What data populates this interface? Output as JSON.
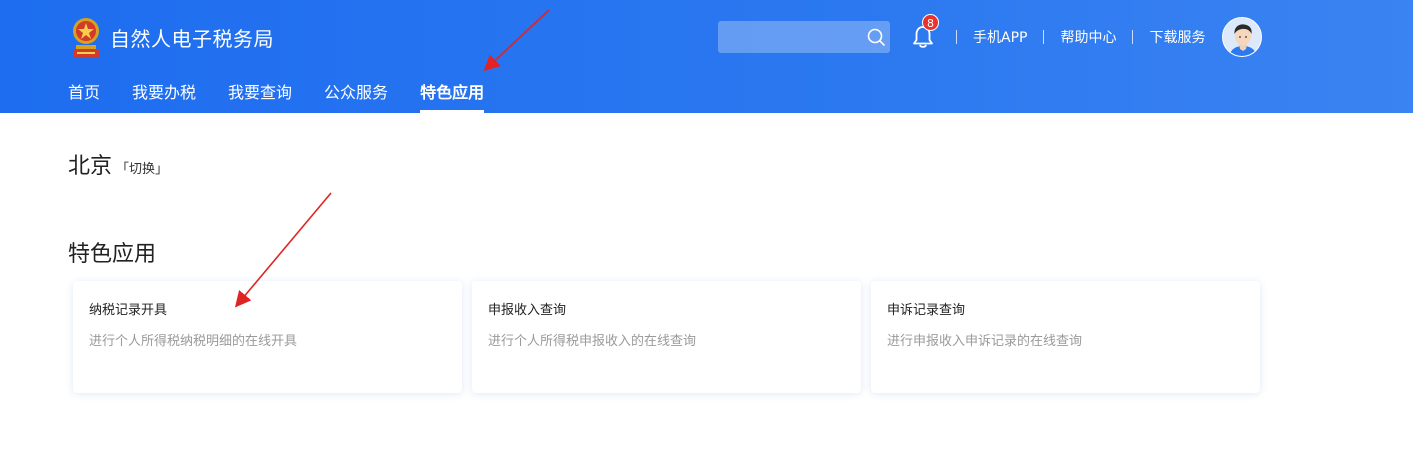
{
  "header": {
    "site_title": "自然人电子税务局",
    "emblem_icon": "tax-emblem-icon",
    "search": {
      "placeholder": "",
      "value": "",
      "icon": "search-icon"
    },
    "notifications": {
      "icon": "bell-icon",
      "count": "8"
    },
    "links": [
      "手机APP",
      "帮助中心",
      "下载服务"
    ],
    "avatar_icon": "user-avatar-icon"
  },
  "nav": {
    "items": [
      "首页",
      "我要办税",
      "我要查询",
      "公众服务",
      "特色应用"
    ],
    "active_index": 4
  },
  "location": {
    "city": "北京",
    "switch_label": "「切换」"
  },
  "section": {
    "title": "特色应用",
    "cards": [
      {
        "title": "纳税记录开具",
        "desc": "进行个人所得税纳税明细的在线开具"
      },
      {
        "title": "申报收入查询",
        "desc": "进行个人所得税申报收入的在线查询"
      },
      {
        "title": "申诉记录查询",
        "desc": "进行申报收入申诉记录的在线查询"
      }
    ]
  },
  "colors": {
    "header_blue": "#1e6df0",
    "badge_red": "#e8322e",
    "annotation_red": "#e02424"
  }
}
